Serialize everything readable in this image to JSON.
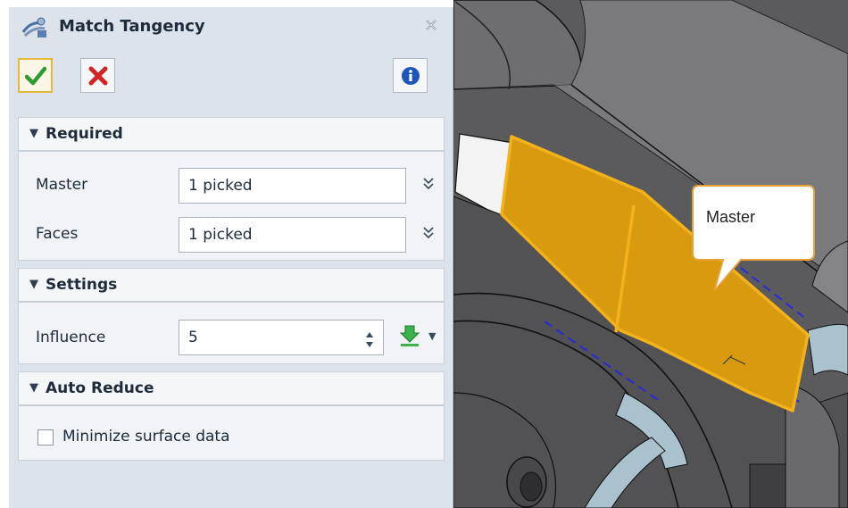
{
  "dialog": {
    "title": "Match Tangency",
    "title_icon": "match-tangency-icon",
    "toolbar": {
      "ok_icon": "checkmark-icon",
      "cancel_icon": "red-x-icon",
      "info_icon": "info-icon"
    },
    "sections": {
      "required": {
        "label": "Required",
        "master_label": "Master",
        "master_value": "1 picked",
        "faces_label": "Faces",
        "faces_value": "1 picked"
      },
      "settings": {
        "label": "Settings",
        "influence_label": "Influence",
        "influence_value": "5"
      },
      "auto_reduce": {
        "label": "Auto Reduce",
        "minimize_label": "Minimize surface data",
        "minimize_checked": false
      }
    }
  },
  "viewport": {
    "callout": "Master",
    "highlight_color": "#e6a400"
  }
}
